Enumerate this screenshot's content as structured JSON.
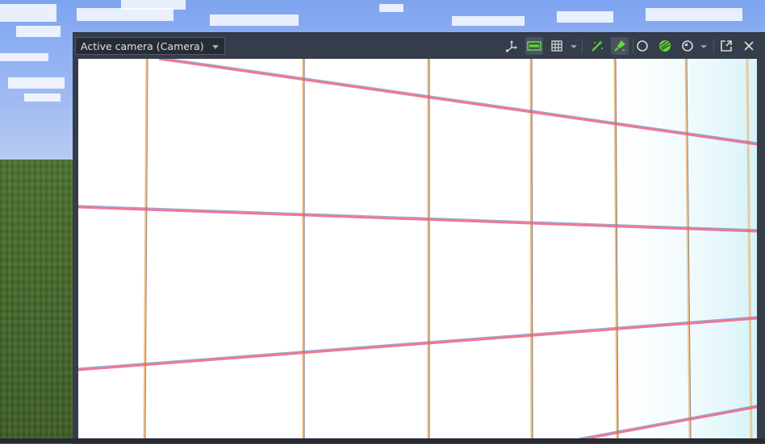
{
  "preview": {
    "camera_select": {
      "selected": "Active camera (Camera)"
    },
    "toolbar_icons": [
      "transform-gizmo-icon",
      "frame-icon",
      "grid-icon",
      "magic-wand-icon",
      "light-icon",
      "circle-icon",
      "sphere-texture-icon",
      "environment-icon",
      "popout-icon",
      "close-icon"
    ]
  },
  "colors": {
    "toolbar_bg": "#363d4a",
    "accent_green": "#61d836",
    "grid_line_orange": "#f0a24a",
    "grid_line_pink": "#f06080",
    "grid_line_blue": "#6a8ac8"
  }
}
